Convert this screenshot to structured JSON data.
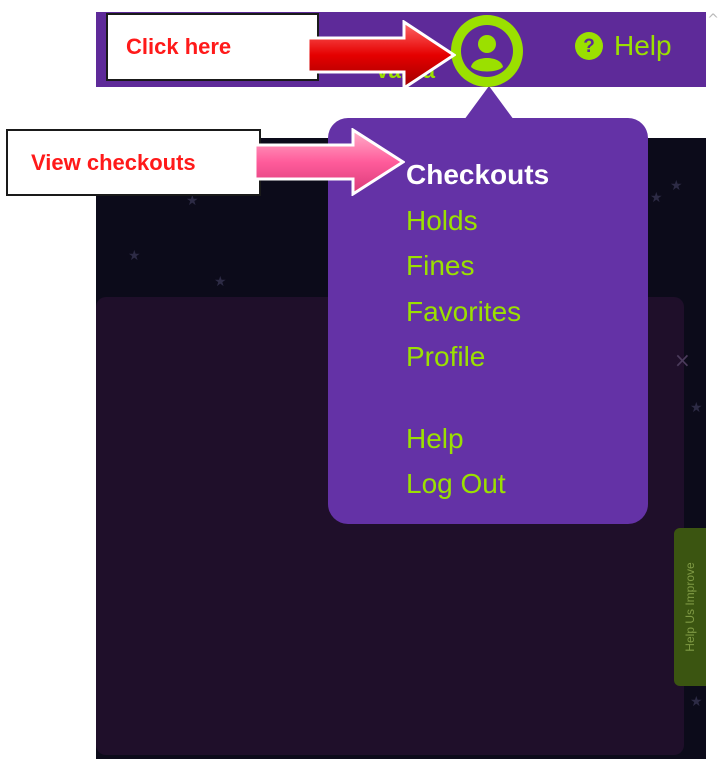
{
  "header": {
    "user_name": "Varda",
    "help_label": "Help",
    "help_icon": "question-circle-icon",
    "avatar_icon": "user-avatar-icon",
    "colors": {
      "bar": "#5e2a99",
      "accent": "#9be000"
    }
  },
  "menu": {
    "items": [
      {
        "label": "Checkouts"
      },
      {
        "label": "Holds"
      },
      {
        "label": "Fines"
      },
      {
        "label": "Favorites"
      },
      {
        "label": "Profile"
      }
    ],
    "secondary": [
      {
        "label": "Help"
      },
      {
        "label": "Log Out"
      }
    ],
    "colors": {
      "background": "#6432a6",
      "item": "#9be000",
      "active": "#ffffff"
    }
  },
  "annotations": {
    "click_here": "Click here",
    "view_checkouts": "View checkouts",
    "arrow_colors": {
      "first": "#ff1a1a",
      "second": "#ff5c9b"
    }
  },
  "feedback_tab": {
    "label": "Help Us Improve"
  }
}
